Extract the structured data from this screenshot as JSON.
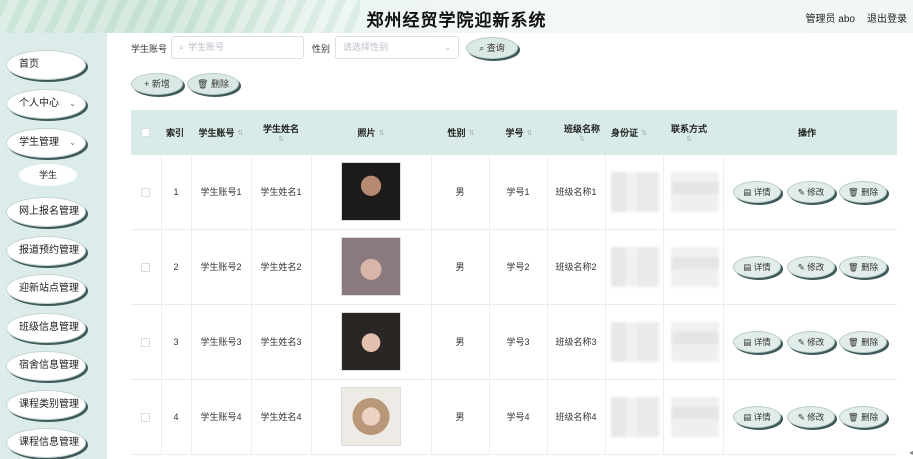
{
  "header": {
    "title": "郑州经贸学院迎新系统",
    "user": "管理员 abo",
    "logout": "退出登录"
  },
  "sidebar": {
    "items": [
      {
        "label": "首页",
        "expandable": false
      },
      {
        "label": "个人中心",
        "expandable": true
      },
      {
        "label": "学生管理",
        "expandable": true
      },
      {
        "label": "网上报名管理",
        "expandable": false
      },
      {
        "label": "报道预约管理",
        "expandable": false
      },
      {
        "label": "迎新站点管理",
        "expandable": false
      },
      {
        "label": "班级信息管理",
        "expandable": false
      },
      {
        "label": "宿舍信息管理",
        "expandable": false
      },
      {
        "label": "课程类别管理",
        "expandable": false
      },
      {
        "label": "课程信息管理",
        "expandable": false
      }
    ],
    "sub_item": "学生",
    "chevron": "⌄"
  },
  "search": {
    "account_label": "学生账号",
    "account_placeholder": "学生账号",
    "gender_label": "性别",
    "gender_placeholder": "请选择性别",
    "query_btn": "查询",
    "search_icon": "⌕"
  },
  "toolbar": {
    "add_btn": "新增",
    "delete_btn": "删除",
    "plus_icon": "+",
    "trash_icon": "🗑"
  },
  "table": {
    "columns": [
      "索引",
      "学生账号",
      "学生姓名",
      "照片",
      "性别",
      "学号",
      "班级名称",
      "身份证",
      "联系方式",
      "操作"
    ],
    "sort_icon": "⇅",
    "rows": [
      {
        "index": "1",
        "account": "学生账号1",
        "name": "学生姓名1",
        "gender": "男",
        "student_no": "学号1",
        "class_name": "班级名称1"
      },
      {
        "index": "2",
        "account": "学生账号2",
        "name": "学生姓名2",
        "gender": "男",
        "student_no": "学号2",
        "class_name": "班级名称2"
      },
      {
        "index": "3",
        "account": "学生账号3",
        "name": "学生姓名3",
        "gender": "男",
        "student_no": "学号3",
        "class_name": "班级名称3"
      },
      {
        "index": "4",
        "account": "学生账号4",
        "name": "学生姓名4",
        "gender": "男",
        "student_no": "学号4",
        "class_name": "班级名称4"
      }
    ],
    "actions": {
      "detail": "详情",
      "edit": "修改",
      "delete": "删除"
    }
  },
  "colors": {
    "sidebar_bg": "#dbeceb",
    "table_header_bg": "#d9ebe8",
    "pill_shadow": "#3f5a5a"
  }
}
